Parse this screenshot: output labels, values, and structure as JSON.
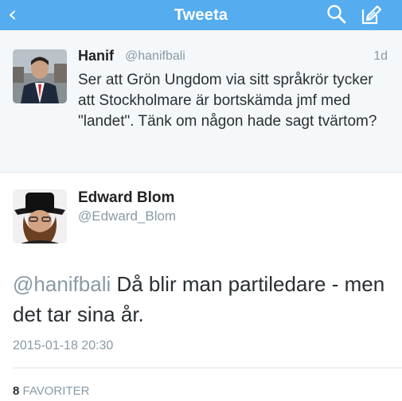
{
  "nav": {
    "title": "Tweeta",
    "back_icon": "chevron-left-icon",
    "search_icon": "search-icon",
    "compose_icon": "compose-icon",
    "background": "#55acee"
  },
  "reply_context": {
    "name": "Hanif",
    "handle": "@hanifbali",
    "time": "1d",
    "text": "Ser att Grön Ungdom via sitt språkrör tycker att Stockholmare är bortskämda jmf med \"landet\". Tänk om någon hade sagt tvärtom?"
  },
  "tweet": {
    "name": "Edward Blom",
    "handle": "@Edward_Blom",
    "mention": "@hanifbali",
    "text": " Då blir man partiledare - men det tar sina år.",
    "timestamp": "2015-01-18 20:30",
    "favorites_count": "8",
    "favorites_label": "FAVORITER"
  }
}
